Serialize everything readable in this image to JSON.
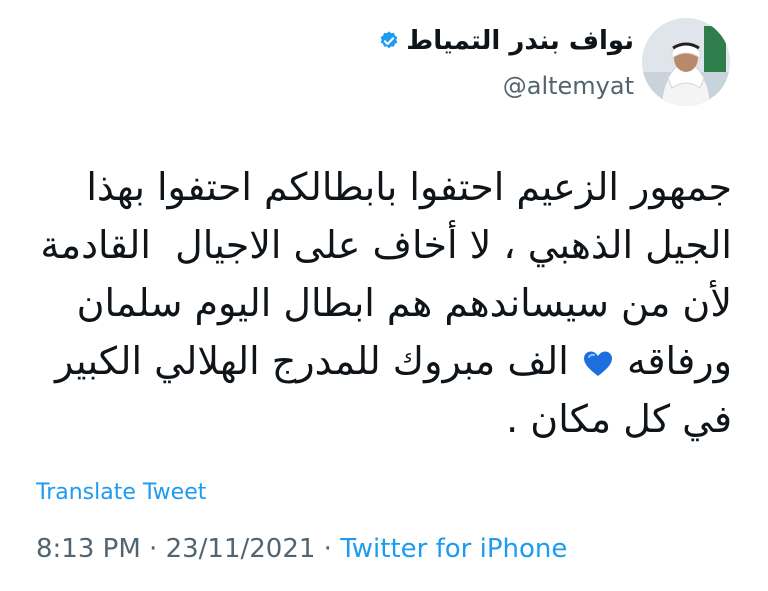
{
  "menu": {
    "icon": "more-horizontal-icon"
  },
  "author": {
    "display_name": "نواف بندر التمياط",
    "handle": "@altemyat",
    "verified_icon": "verified-badge-icon",
    "avatar_icon": "avatar"
  },
  "tweet": {
    "line1": "جمهور الزعيم احتفوا بابطالكم احتفوا بهذا",
    "line2": "الجيل الذهبي ، لا أخاف على الاجيال  القادمة",
    "line3": "لأن من سيساندهم هم ابطال اليوم سلمان",
    "line4a": "ورفاقه",
    "heart_icon": "blue-heart-icon",
    "line4b": "الف مبروك للمدرج الهلالي الكبير",
    "line5": "في كل مكان ."
  },
  "translate_label": "Translate Tweet",
  "meta": {
    "time": "8:13 PM",
    "sep1": " · ",
    "date": "23/11/2021",
    "sep2": " · ",
    "source": "Twitter for iPhone"
  },
  "colors": {
    "accent": "#1d9bf0",
    "secondary_text": "#536471",
    "heart": "#1d6fe0"
  }
}
